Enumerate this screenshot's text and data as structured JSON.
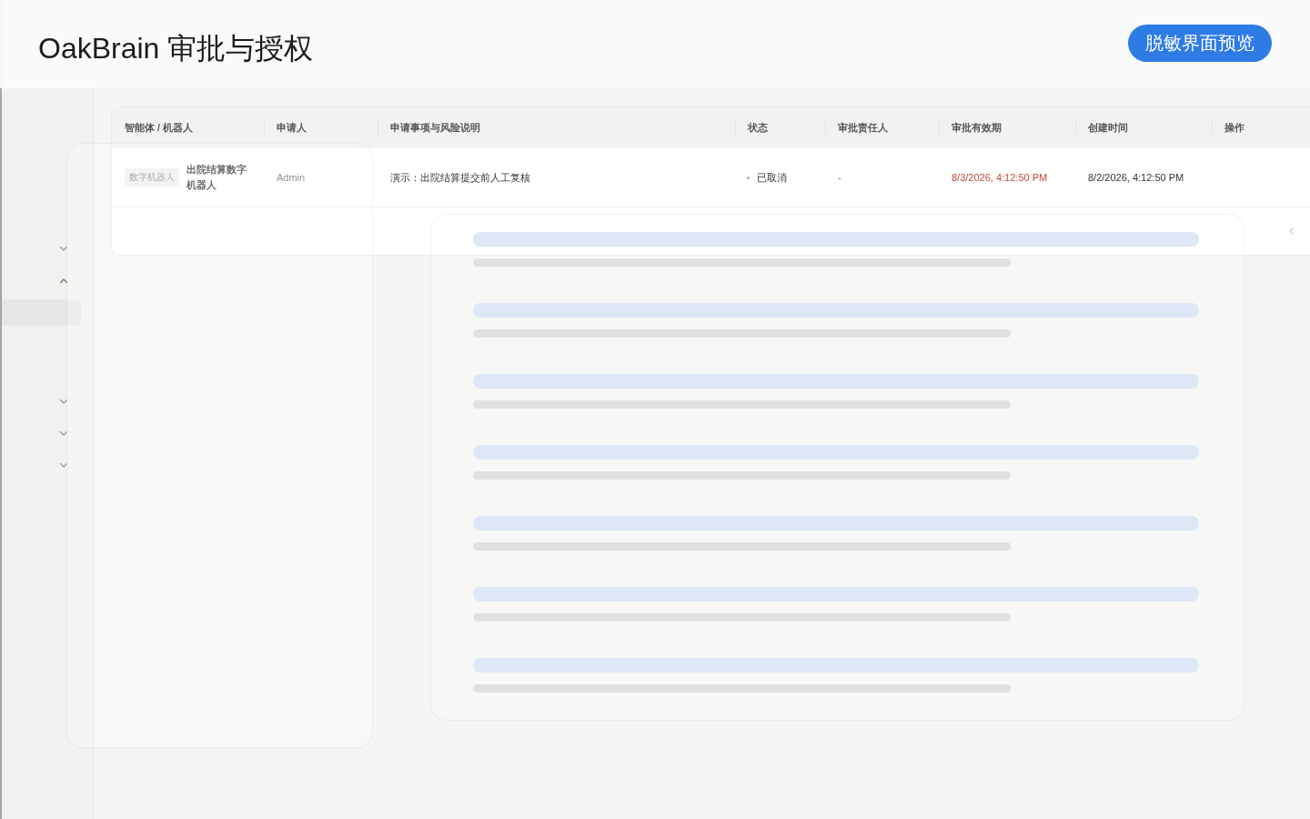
{
  "header": {
    "title": "OakBrain 审批与授权",
    "preview_button": "脱敏界面预览"
  },
  "sidebar": {
    "items": [
      {
        "expanded": false
      },
      {
        "expanded": true,
        "children": [
          {
            "selected": true
          }
        ]
      },
      {
        "expanded": false
      },
      {
        "expanded": false
      },
      {
        "expanded": false
      }
    ]
  },
  "table": {
    "columns": [
      "智能体 / 机器人",
      "申请人",
      "申请事项与风险说明",
      "状态",
      "审批责任人",
      "审批有效期",
      "创建时间",
      "操作"
    ],
    "rows": [
      {
        "tag": "数字机器人",
        "name": "出院结算数字机器人",
        "applicant": "Admin",
        "request": "演示：出院结算提交前人工复核",
        "status": "已取消",
        "approver": "-",
        "validity": {
          "text": "8/3/2026, 4:12:50 PM",
          "expired": true
        },
        "created": "8/2/2026, 4:12:50 PM"
      }
    ],
    "pagination": {
      "previous_disabled": true
    }
  },
  "loading": true
}
